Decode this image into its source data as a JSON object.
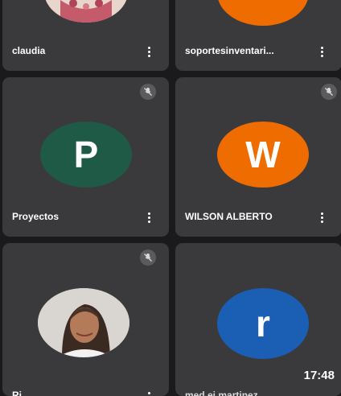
{
  "tiles": [
    {
      "name": "claudia",
      "avatar_type": "photo"
    },
    {
      "name": "soportesinventari...",
      "avatar_color": "#ef6c00"
    },
    {
      "name": "Proyectos",
      "initial": "P",
      "avatar_color": "#1e5a45",
      "muted": true
    },
    {
      "name": "WILSON ALBERTO",
      "initial": "W",
      "avatar_color": "#ef6c00",
      "muted": true
    },
    {
      "name": "Ri...",
      "avatar_type": "photo",
      "muted": true
    },
    {
      "name": "med ei martinez...",
      "initial": "r",
      "avatar_color": "#1a5fb4"
    }
  ],
  "status_bar": {
    "time": "17:48"
  },
  "icons": {
    "mute": "mic-off-icon",
    "menu": "more-vert-icon"
  }
}
